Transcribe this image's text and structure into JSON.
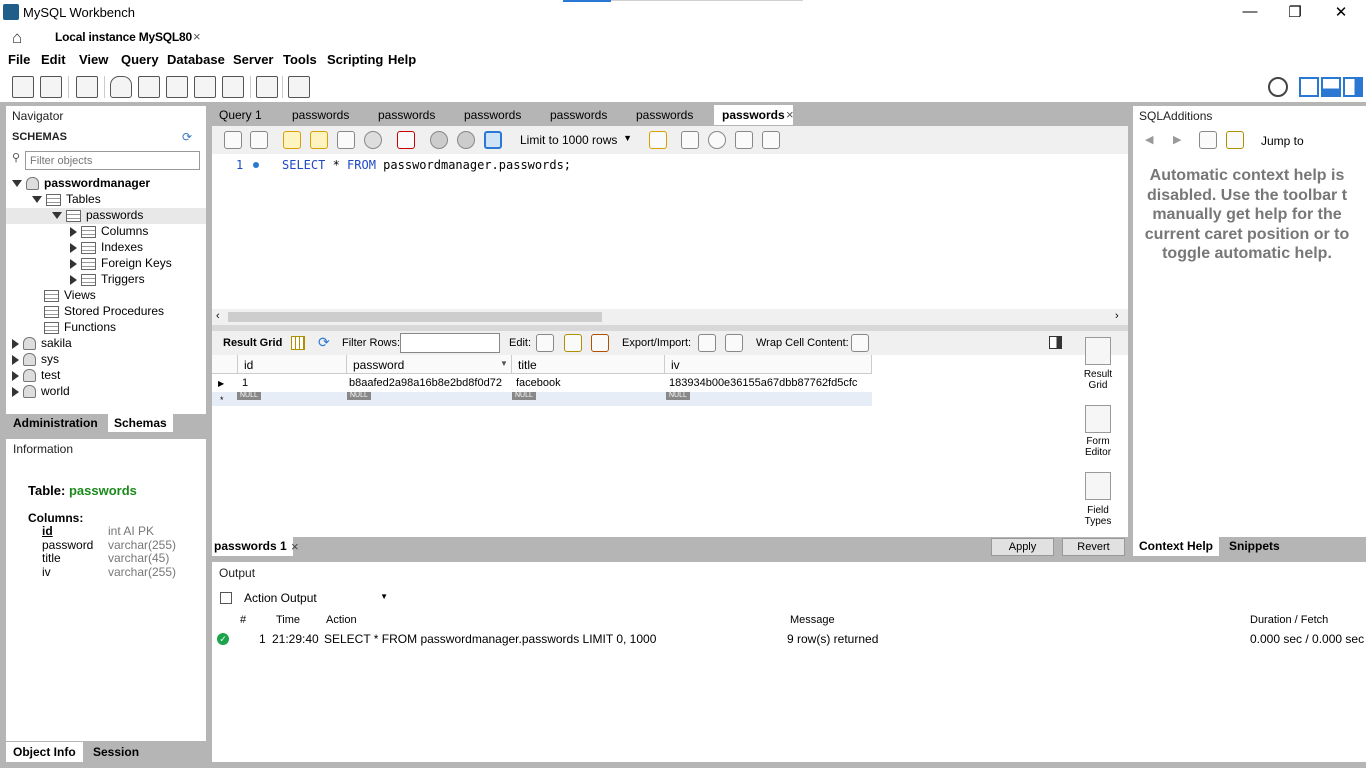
{
  "window": {
    "title": "MySQL Workbench",
    "minimize": "—",
    "restore": "❐",
    "close": "✕"
  },
  "connection_tab": {
    "label": "Local instance MySQL80",
    "close": "×"
  },
  "menu": [
    "File",
    "Edit",
    "View",
    "Query",
    "Database",
    "Server",
    "Tools",
    "Scripting",
    "Help"
  ],
  "navigator": {
    "title": "Navigator",
    "schemas_label": "SCHEMAS",
    "filter_placeholder": "Filter objects",
    "tree": {
      "db": "passwordmanager",
      "tables": "Tables",
      "table": "passwords",
      "columns": "Columns",
      "indexes": "Indexes",
      "foreign_keys": "Foreign Keys",
      "triggers": "Triggers",
      "views": "Views",
      "stored_procedures": "Stored Procedures",
      "functions": "Functions",
      "other_dbs": [
        "sakila",
        "sys",
        "test",
        "world"
      ]
    },
    "tabs": {
      "administration": "Administration",
      "schemas": "Schemas"
    }
  },
  "information": {
    "title": "Information",
    "table_label": "Table:",
    "table_name": "passwords",
    "columns_label": "Columns:",
    "columns": [
      {
        "name": "id",
        "type": "int AI PK"
      },
      {
        "name": "password",
        "type": "varchar(255)"
      },
      {
        "name": "title",
        "type": "varchar(45)"
      },
      {
        "name": "iv",
        "type": "varchar(255)"
      }
    ],
    "tabs": {
      "object_info": "Object Info",
      "session": "Session"
    }
  },
  "editor_tabs": [
    "Query 1",
    "passwords",
    "passwords",
    "passwords",
    "passwords",
    "passwords",
    "passwords"
  ],
  "editor_tab_close": "×",
  "sql_toolbar": {
    "limit_label": "Limit to 1000 rows"
  },
  "editor": {
    "line_no": "1",
    "select": "SELECT",
    "star": " * ",
    "from": "FROM",
    "rest": " passwordmanager.passwords;"
  },
  "result_bar": {
    "result_grid": "Result Grid",
    "filter_rows": "Filter Rows:",
    "edit": "Edit:",
    "export_import": "Export/Import:",
    "wrap": "Wrap Cell Content:"
  },
  "grid": {
    "headers": [
      "id",
      "password",
      "title",
      "iv"
    ],
    "rows": [
      [
        "1",
        "b8aafed2a98a16b8e2bd8f0d72",
        "facebook",
        "183934b00e36155a67dbb87762fd5cfc"
      ]
    ],
    "null_label": "NULL",
    "new_row_marker": "*"
  },
  "side_panel": {
    "result_grid": [
      "Result",
      "Grid"
    ],
    "form_editor": [
      "Form",
      "Editor"
    ],
    "field_types": [
      "Field",
      "Types"
    ]
  },
  "result_tab": {
    "label": "passwords 1",
    "close": "×"
  },
  "buttons": {
    "apply": "Apply",
    "revert": "Revert"
  },
  "sql_additions": {
    "title": "SQLAdditions",
    "jump_to": "Jump to",
    "help_lines": [
      "Automatic context help is",
      "disabled. Use the toolbar t",
      "manually get help for the",
      "current caret position or to",
      "toggle automatic help."
    ],
    "tabs": {
      "context_help": "Context Help",
      "snippets": "Snippets"
    }
  },
  "output": {
    "title": "Output",
    "selector": "Action Output",
    "headers": {
      "num": "#",
      "time": "Time",
      "action": "Action",
      "message": "Message",
      "duration": "Duration / Fetch"
    },
    "rows": [
      {
        "num": "1",
        "time": "21:29:40",
        "action": "SELECT * FROM passwordmanager.passwords LIMIT 0, 1000",
        "message": "9 row(s) returned",
        "duration": "0.000 sec / 0.000 sec"
      }
    ]
  },
  "colors": {
    "accent": "#2b78d4",
    "table_green": "#1a8a1a",
    "keyword_blue": "#1f48c4",
    "success": "#1aa34a"
  }
}
